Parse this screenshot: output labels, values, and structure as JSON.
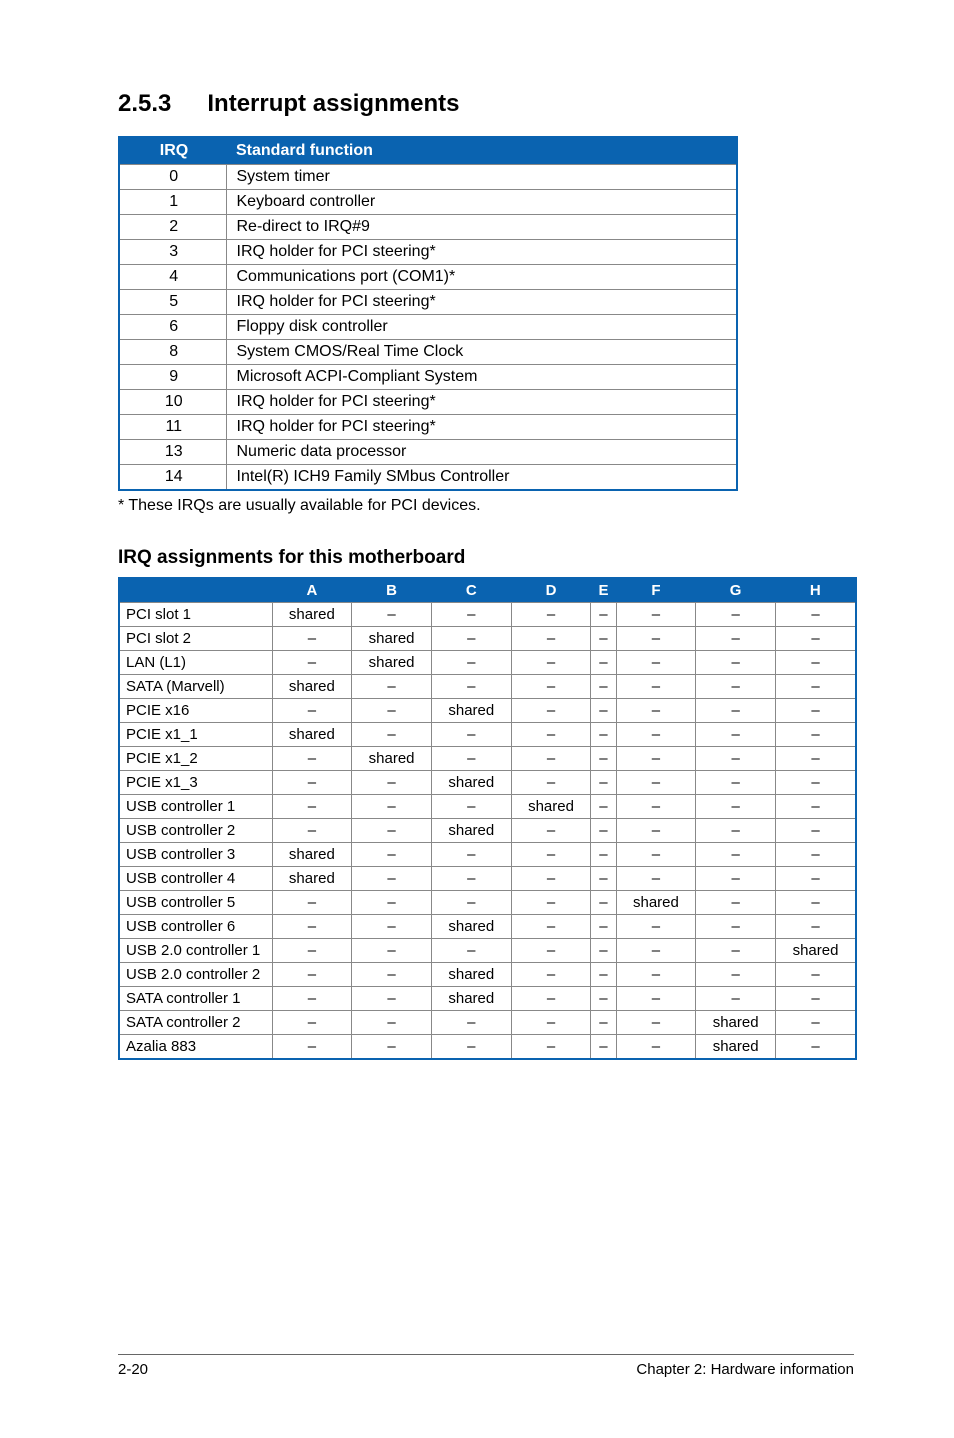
{
  "section": {
    "number": "2.5.3",
    "title": "Interrupt assignments"
  },
  "irq_table": {
    "headers": {
      "irq": "IRQ",
      "func": "Standard function"
    },
    "rows": [
      {
        "irq": "0",
        "func": "System timer"
      },
      {
        "irq": "1",
        "func": "Keyboard controller"
      },
      {
        "irq": "2",
        "func": "Re-direct to IRQ#9"
      },
      {
        "irq": "3",
        "func": "IRQ holder for PCI steering*"
      },
      {
        "irq": "4",
        "func": "Communications port (COM1)*"
      },
      {
        "irq": "5",
        "func": "IRQ holder for PCI steering*"
      },
      {
        "irq": "6",
        "func": "Floppy disk controller"
      },
      {
        "irq": "8",
        "func": "System CMOS/Real Time Clock"
      },
      {
        "irq": "9",
        "func": "Microsoft ACPI-Compliant System"
      },
      {
        "irq": "10",
        "func": "IRQ holder for PCI steering*"
      },
      {
        "irq": "11",
        "func": "IRQ holder for PCI steering*"
      },
      {
        "irq": "13",
        "func": "Numeric data processor"
      },
      {
        "irq": "14",
        "func": "Intel(R) ICH9 Family SMbus Controller"
      }
    ]
  },
  "footnote": "* These IRQs are usually available for PCI devices.",
  "sub_heading": "IRQ assignments for this motherboard",
  "assign_table": {
    "cols": [
      "A",
      "B",
      "C",
      "D",
      "E",
      "F",
      "G",
      "H"
    ],
    "rows": [
      {
        "device": "PCI slot 1",
        "cells": [
          "shared",
          "–",
          "–",
          "–",
          "–",
          "–",
          "–",
          "–"
        ]
      },
      {
        "device": "PCI slot 2",
        "cells": [
          "–",
          "shared",
          "–",
          "–",
          "–",
          "–",
          "–",
          "–"
        ]
      },
      {
        "device": "LAN (L1)",
        "cells": [
          "–",
          "shared",
          "–",
          "–",
          "–",
          "–",
          "–",
          "–"
        ]
      },
      {
        "device": "SATA (Marvell)",
        "cells": [
          "shared",
          "–",
          "–",
          "–",
          "–",
          "–",
          "–",
          "–"
        ]
      },
      {
        "device": "PCIE x16",
        "cells": [
          "–",
          "–",
          "shared",
          "–",
          "–",
          "–",
          "–",
          "–"
        ]
      },
      {
        "device": "PCIE x1_1",
        "cells": [
          "shared",
          "–",
          "–",
          "–",
          "–",
          "–",
          "–",
          "–"
        ]
      },
      {
        "device": "PCIE x1_2",
        "cells": [
          "–",
          "shared",
          "–",
          "–",
          "–",
          "–",
          "–",
          "–"
        ]
      },
      {
        "device": "PCIE x1_3",
        "cells": [
          "–",
          "–",
          "shared",
          "–",
          "–",
          "–",
          "–",
          "–"
        ]
      },
      {
        "device": "USB controller 1",
        "cells": [
          "–",
          "–",
          "–",
          "shared",
          "–",
          "–",
          "–",
          "–"
        ]
      },
      {
        "device": "USB controller 2",
        "cells": [
          "–",
          "–",
          "shared",
          "–",
          "–",
          "–",
          "–",
          "–"
        ]
      },
      {
        "device": "USB controller 3",
        "cells": [
          "shared",
          "–",
          "–",
          "–",
          "–",
          "–",
          "–",
          "–"
        ]
      },
      {
        "device": "USB controller 4",
        "cells": [
          "shared",
          "–",
          "–",
          "–",
          "–",
          "–",
          "–",
          "–"
        ]
      },
      {
        "device": "USB controller 5",
        "cells": [
          "–",
          "–",
          "–",
          "–",
          "–",
          "shared",
          "–",
          "–"
        ]
      },
      {
        "device": "USB controller 6",
        "cells": [
          "–",
          "–",
          "shared",
          "–",
          "–",
          "–",
          "–",
          "–"
        ]
      },
      {
        "device": "USB 2.0 controller 1",
        "cells": [
          "–",
          "–",
          "–",
          "–",
          "–",
          "–",
          "–",
          "shared"
        ]
      },
      {
        "device": "USB 2.0 controller 2",
        "cells": [
          "–",
          "–",
          "shared",
          "–",
          "–",
          "–",
          "–",
          "–"
        ]
      },
      {
        "device": "SATA controller 1",
        "cells": [
          "–",
          "–",
          "shared",
          "–",
          "–",
          "–",
          "–",
          "–"
        ]
      },
      {
        "device": "SATA controller 2",
        "cells": [
          "–",
          "–",
          "–",
          "–",
          "–",
          "–",
          "shared",
          "–"
        ]
      },
      {
        "device": "Azalia 883",
        "cells": [
          "–",
          "–",
          "–",
          "–",
          "–",
          "–",
          "shared",
          "–"
        ]
      }
    ]
  },
  "footer": {
    "left": "2-20",
    "right": "Chapter 2: Hardware information"
  }
}
